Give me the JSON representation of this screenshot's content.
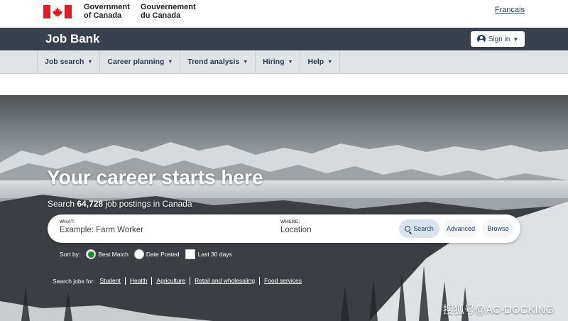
{
  "gov_header": {
    "signature_en": [
      "Government",
      "of Canada"
    ],
    "signature_fr": [
      "Gouvernement",
      "du Canada"
    ],
    "language_link": "Français"
  },
  "app_bar": {
    "title": "Job Bank",
    "sign_in_label": "Sign in"
  },
  "menu": {
    "items": [
      {
        "label": "Job search"
      },
      {
        "label": "Career planning"
      },
      {
        "label": "Trend analysis"
      },
      {
        "label": "Hiring"
      },
      {
        "label": "Help"
      }
    ]
  },
  "hero": {
    "title": "Your career starts here",
    "sub_prefix": "Search",
    "sub_count": "64,728",
    "sub_suffix": "job postings in Canada"
  },
  "search": {
    "what_label": "WHAT:",
    "what_placeholder": "Example: Farm Worker",
    "where_label": "WHERE:",
    "where_placeholder": "Location",
    "search_button": "Search",
    "advanced_button": "Advanced",
    "browse_button": "Browse"
  },
  "sort": {
    "label": "Sort by:",
    "options": [
      {
        "label": "Best Match",
        "selected": true
      },
      {
        "label": "Date Posted",
        "selected": false
      }
    ],
    "filter_label": "Last 30 days"
  },
  "quick_links": {
    "lead": "Search jobs for:",
    "items": [
      "Student",
      "Health",
      "Agriculture",
      "Retail and wholesaling",
      "Food services"
    ]
  },
  "watermark": "搜狐号@AC-DOCKING",
  "colors": {
    "flag_red": "#e31b23",
    "app_bar": "#38414d",
    "link_blue": "#284162",
    "radio_selected": "#1e8a2e"
  }
}
